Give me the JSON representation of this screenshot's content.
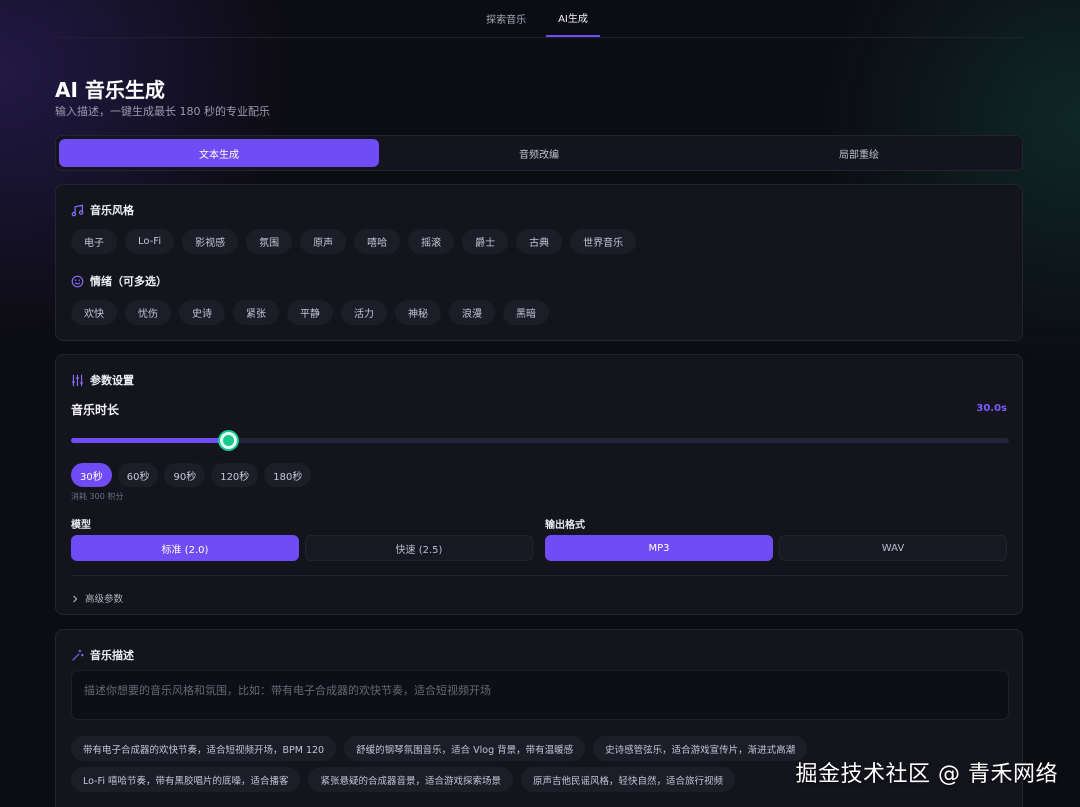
{
  "nav": {
    "tabs": [
      "探索音乐",
      "AI生成"
    ],
    "active": 1
  },
  "page": {
    "title": "AI 音乐生成",
    "subtitle": "输入描述，一键生成最长 180 秒的专业配乐"
  },
  "modes": {
    "items": [
      "文本生成",
      "音频改编",
      "局部重绘"
    ],
    "active": 0
  },
  "style": {
    "label": "音乐风格",
    "icon": "music-note-icon",
    "options": [
      "电子",
      "Lo-Fi",
      "影视感",
      "氛围",
      "原声",
      "嘻哈",
      "摇滚",
      "爵士",
      "古典",
      "世界音乐"
    ]
  },
  "mood": {
    "label": "情绪（可多选）",
    "icon": "smile-icon",
    "options": [
      "欢快",
      "忧伤",
      "史诗",
      "紧张",
      "平静",
      "活力",
      "神秘",
      "浪漫",
      "黑暗"
    ]
  },
  "params": {
    "label": "参数设置",
    "icon": "sliders-icon",
    "duration_label": "音乐时长",
    "duration_value": "30.0s",
    "duration_fraction": 0.167,
    "presets": [
      "30秒",
      "60秒",
      "90秒",
      "120秒",
      "180秒"
    ],
    "preset_active": 0,
    "cost": "消耗 300 积分",
    "model_label": "模型",
    "models": [
      "标准 (2.0)",
      "快速 (2.5)"
    ],
    "model_active": 0,
    "format_label": "输出格式",
    "formats": [
      "MP3",
      "WAV"
    ],
    "format_active": 0,
    "advanced": "高级参数"
  },
  "describe": {
    "label": "音乐描述",
    "icon": "magic-wand-icon",
    "placeholder": "描述你想要的音乐风格和氛围，比如：带有电子合成器的欢快节奏，适合短视频开场",
    "suggestions_row1": [
      "带有电子合成器的欢快节奏，适合短视频开场，BPM 120",
      "舒缓的钢琴氛围音乐，适合 Vlog 背景，带有温暖感",
      "史诗感管弦乐，适合游戏宣传片，渐进式高潮"
    ],
    "suggestions_row2": [
      "Lo-Fi 嘻哈节奏，带有黑胶唱片的底噪，适合播客",
      "紧张悬疑的合成器音景，适合游戏探索场景",
      "原声吉他民谣风格，轻快自然，适合旅行视频"
    ]
  },
  "watermark": "掘金技术社区 @ 青禾网络",
  "colors": {
    "accent": "#6f4cf5",
    "thumb": "#17c98f",
    "background": "#0c0c13",
    "card": "#13141c"
  }
}
